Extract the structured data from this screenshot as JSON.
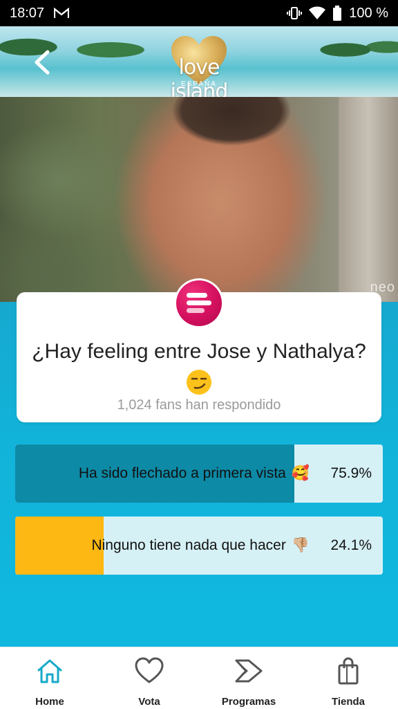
{
  "status_bar": {
    "time": "18:07",
    "battery": "100 %"
  },
  "header": {
    "logo_text": "love island",
    "logo_sub": "ESPAÑA"
  },
  "hero": {
    "watermark": "neo"
  },
  "poll": {
    "question": "¿Hay feeling entre Jose y Nathalya?",
    "question_emoji": "😏",
    "responses": "1,024 fans han respondido",
    "options": [
      {
        "label": "Ha sido flechado a primera vista",
        "emoji": "🥰",
        "percent_text": "75.9%",
        "percent": 75.9,
        "color": "#0d8aa6"
      },
      {
        "label": "Ninguno tiene nada que hacer",
        "emoji": "👎🏼",
        "percent_text": "24.1%",
        "percent": 24.1,
        "color": "#fdb813"
      }
    ]
  },
  "nav": {
    "items": [
      {
        "label": "Home",
        "icon": "home-icon",
        "active": true
      },
      {
        "label": "Vota",
        "icon": "heart-icon",
        "active": false
      },
      {
        "label": "Programas",
        "icon": "programs-icon",
        "active": false
      },
      {
        "label": "Tienda",
        "icon": "shopping-bag-icon",
        "active": false
      }
    ]
  },
  "colors": {
    "accent": "#18a9c9",
    "content_bg": "#12b3d9",
    "badge": "#d3105f"
  }
}
